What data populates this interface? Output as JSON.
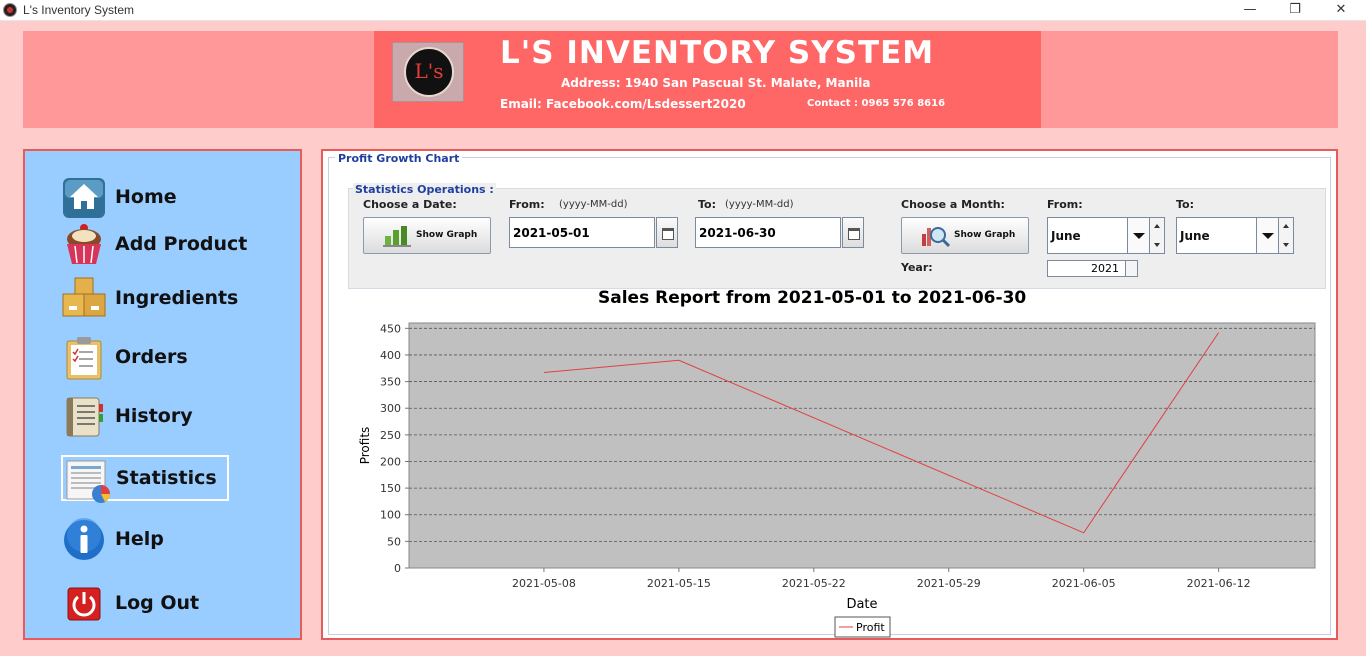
{
  "window": {
    "title": "L's Inventory System",
    "minimize_glyph": "—",
    "maximize_glyph": "❐",
    "close_glyph": "✕"
  },
  "header": {
    "logo_text": "L's",
    "title": "L'S INVENTORY SYSTEM",
    "address": "Address: 1940 San Pascual St. Malate, Manila",
    "email": "Email: Facebook.com/Lsdessert2020",
    "contact": "Contact : 0965 576 8616"
  },
  "sidebar": {
    "items": [
      {
        "label": "Home",
        "icon": "home-icon"
      },
      {
        "label": "Add Product",
        "icon": "cupcake-icon"
      },
      {
        "label": "Ingredients",
        "icon": "boxes-icon"
      },
      {
        "label": "Orders",
        "icon": "clipboard-icon"
      },
      {
        "label": "History",
        "icon": "book-icon"
      },
      {
        "label": "Statistics",
        "icon": "statistics-icon",
        "active": true
      },
      {
        "label": "Help",
        "icon": "info-icon"
      },
      {
        "label": "Log Out",
        "icon": "power-icon"
      }
    ]
  },
  "main": {
    "panel_title": "Profit Growth Chart",
    "ops": {
      "title": "Statistics Operations :",
      "choose_date_label": "Choose a Date:",
      "show_graph_label": "Show Graph",
      "from_label": "From:",
      "from_hint": "(yyyy-MM-dd)",
      "from_value": "2021-05-01",
      "to_label": "To:",
      "to_hint": "(yyyy-MM-dd)",
      "to_value": "2021-06-30",
      "choose_month_label": "Choose a Month:",
      "show_graph_month_label": "Show Graph",
      "month_from_label": "From:",
      "month_from_value": "June",
      "month_to_label": "To:",
      "month_to_value": "June",
      "year_label": "Year:",
      "year_value": "2021"
    }
  },
  "colors": {
    "header_bg": "#ff9999",
    "header_inner": "#ff6666",
    "sidebar_bg": "#99ccff",
    "border_red": "#e85b5b",
    "plot_bg": "#c0c0c0",
    "series_line": "#e04040",
    "label_blue": "#1f3f9f"
  },
  "chart_data": {
    "type": "line",
    "title": "Sales Report from 2021-05-01 to 2021-06-30",
    "xlabel": "Date",
    "ylabel": "Profits",
    "ylim": [
      0,
      460
    ],
    "yticks": [
      0,
      50,
      100,
      150,
      200,
      250,
      300,
      350,
      400,
      450
    ],
    "xlim": [
      "2021-05-01",
      "2021-06-17"
    ],
    "xticks": [
      "2021-05-08",
      "2021-05-15",
      "2021-05-22",
      "2021-05-29",
      "2021-06-05",
      "2021-06-12"
    ],
    "grid": "horizontal dashed",
    "legend": "bottom-center",
    "series": [
      {
        "name": "Profit",
        "x": [
          "2021-05-08",
          "2021-05-15",
          "2021-06-05",
          "2021-06-12"
        ],
        "values": [
          367,
          390,
          66,
          442
        ]
      }
    ]
  }
}
